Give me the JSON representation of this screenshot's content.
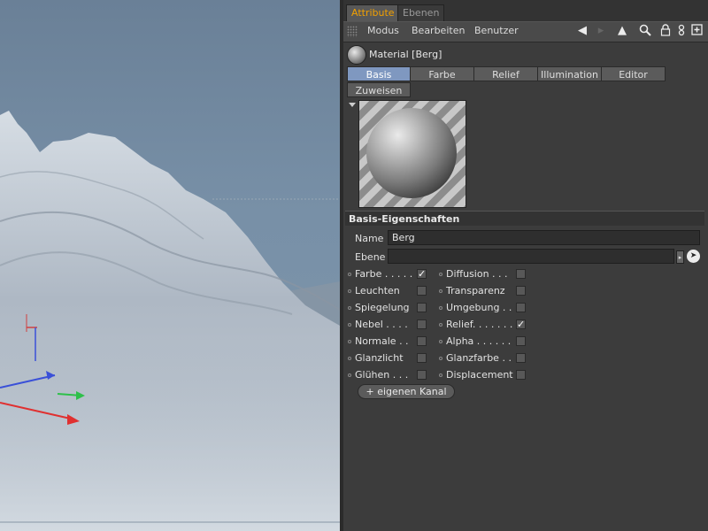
{
  "tabs": [
    {
      "label": "Attribute",
      "active": true
    },
    {
      "label": "Ebenen",
      "active": false
    }
  ],
  "menu": {
    "items": [
      "Modus",
      "Bearbeiten",
      "Benutzer"
    ]
  },
  "toolbar_icons": [
    "back-arrow-icon",
    "forward-arrow-icon",
    "search-icon",
    "lock-icon",
    "link-icon",
    "new-window-icon"
  ],
  "material": {
    "title": "Material [Berg]"
  },
  "property_tabs": [
    "Basis",
    "Farbe",
    "Relief",
    "Illumination",
    "Editor",
    "Zuweisen"
  ],
  "active_property_tab": "Basis",
  "section": {
    "title": "Basis-Eigenschaften"
  },
  "fields": {
    "name_label": "Name",
    "name_value": "Berg",
    "ebene_label": "Ebene",
    "ebene_value": ""
  },
  "channels_left": [
    {
      "label": "Farbe . . . . .",
      "checked": true
    },
    {
      "label": "Leuchten",
      "checked": false
    },
    {
      "label": "Spiegelung",
      "checked": false
    },
    {
      "label": "Nebel . . . .",
      "checked": false
    },
    {
      "label": "Normale . .",
      "checked": false
    },
    {
      "label": "Glanzlicht",
      "checked": false
    },
    {
      "label": "Glühen . . .",
      "checked": false
    }
  ],
  "channels_right": [
    {
      "label": "Diffusion . . .",
      "checked": false
    },
    {
      "label": "Transparenz",
      "checked": false
    },
    {
      "label": "Umgebung . .",
      "checked": false
    },
    {
      "label": "Relief. . . . . . .",
      "checked": true
    },
    {
      "label": "Alpha . . . . . .",
      "checked": false
    },
    {
      "label": "Glanzfarbe . .",
      "checked": false
    },
    {
      "label": "Displacement",
      "checked": false
    }
  ],
  "add_channel_button": "+ eigenen Kanal",
  "colors": {
    "accent_tab": "#f2a000",
    "active_property_tab": "#7f98c0",
    "viewport_sky": "#7890a7"
  }
}
